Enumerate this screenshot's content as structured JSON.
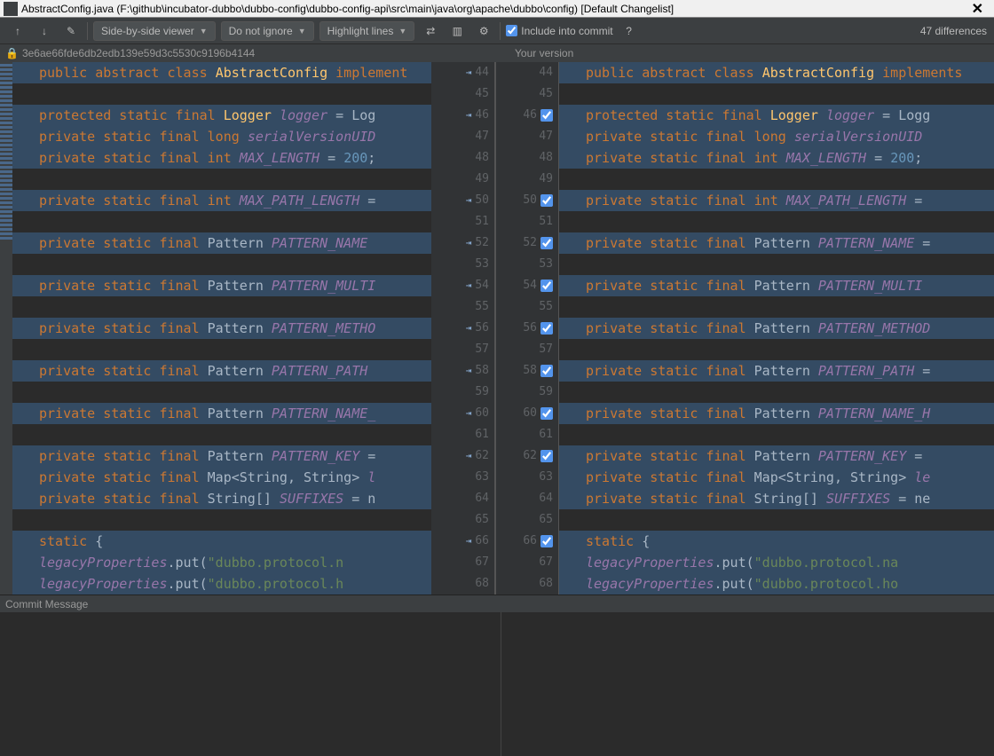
{
  "title": "AbstractConfig.java (F:\\github\\incubator-dubbo\\dubbo-config\\dubbo-config-api\\src\\main\\java\\org\\apache\\dubbo\\config) [Default Changelist]",
  "toolbar": {
    "viewer": "Side-by-side viewer",
    "ignore": "Do not ignore",
    "highlight": "Highlight lines",
    "include": "Include into commit",
    "diffcount": "47 differences"
  },
  "revision": "3e6ae66fde6db2edb139e59d3c5530c9196b4144",
  "header_right": "Your version",
  "left_gutter": [
    {
      "n": "44",
      "a": true
    },
    {
      "n": "45"
    },
    {
      "n": "46",
      "a": true
    },
    {
      "n": "47"
    },
    {
      "n": "48"
    },
    {
      "n": "49"
    },
    {
      "n": "50",
      "a": true
    },
    {
      "n": "51"
    },
    {
      "n": "52",
      "a": true
    },
    {
      "n": "53"
    },
    {
      "n": "54",
      "a": true
    },
    {
      "n": "55"
    },
    {
      "n": "56",
      "a": true
    },
    {
      "n": "57"
    },
    {
      "n": "58",
      "a": true
    },
    {
      "n": "59"
    },
    {
      "n": "60",
      "a": true
    },
    {
      "n": "61"
    },
    {
      "n": "62",
      "a": true
    },
    {
      "n": "63"
    },
    {
      "n": "64"
    },
    {
      "n": "65"
    },
    {
      "n": "66",
      "a": true
    },
    {
      "n": "67"
    },
    {
      "n": "68"
    }
  ],
  "right_gutter": [
    {
      "n": "44"
    },
    {
      "n": "45"
    },
    {
      "n": "46",
      "c": true
    },
    {
      "n": "47"
    },
    {
      "n": "48"
    },
    {
      "n": "49"
    },
    {
      "n": "50",
      "c": true
    },
    {
      "n": "51"
    },
    {
      "n": "52",
      "c": true
    },
    {
      "n": "53"
    },
    {
      "n": "54",
      "c": true
    },
    {
      "n": "55"
    },
    {
      "n": "56",
      "c": true
    },
    {
      "n": "57"
    },
    {
      "n": "58",
      "c": true
    },
    {
      "n": "59"
    },
    {
      "n": "60",
      "c": true
    },
    {
      "n": "61"
    },
    {
      "n": "62",
      "c": true
    },
    {
      "n": "63"
    },
    {
      "n": "64"
    },
    {
      "n": "65"
    },
    {
      "n": "66",
      "c": true
    },
    {
      "n": "67"
    },
    {
      "n": "68"
    }
  ],
  "code_lines": [
    {
      "hl": true,
      "tokens": [
        [
          "kw",
          "public abstract class"
        ],
        [
          "comp",
          " "
        ],
        [
          "cls",
          "AbstractConfig"
        ],
        [
          "comp",
          " "
        ],
        [
          "kw",
          "implement"
        ]
      ]
    },
    {
      "tokens": []
    },
    {
      "hl": true,
      "tokens": [
        [
          "kw",
          "protected static final "
        ],
        [
          "cls",
          "Logger"
        ],
        [
          "comp",
          " "
        ],
        [
          "ident",
          "logger"
        ],
        [
          "op",
          " = "
        ],
        [
          "typ",
          "Log"
        ]
      ]
    },
    {
      "hl": true,
      "tokens": [
        [
          "kw",
          "private static final long "
        ],
        [
          "ident",
          "serialVersionUID"
        ]
      ]
    },
    {
      "hl": true,
      "tokens": [
        [
          "kw",
          "private static final int "
        ],
        [
          "ident",
          "MAX_LENGTH"
        ],
        [
          "op",
          " = "
        ],
        [
          "num",
          "200"
        ],
        [
          "op",
          ";"
        ]
      ]
    },
    {
      "tokens": []
    },
    {
      "hl": true,
      "tokens": [
        [
          "kw",
          "private static final int "
        ],
        [
          "ident",
          "MAX_PATH_LENGTH"
        ],
        [
          "op",
          " ="
        ]
      ]
    },
    {
      "tokens": []
    },
    {
      "hl": true,
      "tokens": [
        [
          "kw",
          "private static final "
        ],
        [
          "typ",
          "Pattern"
        ],
        [
          "comp",
          " "
        ],
        [
          "ident",
          "PATTERN_NAME"
        ]
      ]
    },
    {
      "tokens": []
    },
    {
      "hl": true,
      "tokens": [
        [
          "kw",
          "private static final "
        ],
        [
          "typ",
          "Pattern"
        ],
        [
          "comp",
          " "
        ],
        [
          "ident",
          "PATTERN_MULTI"
        ]
      ]
    },
    {
      "tokens": []
    },
    {
      "hl": true,
      "tokens": [
        [
          "kw",
          "private static final "
        ],
        [
          "typ",
          "Pattern"
        ],
        [
          "comp",
          " "
        ],
        [
          "ident",
          "PATTERN_METHO"
        ]
      ]
    },
    {
      "tokens": []
    },
    {
      "hl": true,
      "tokens": [
        [
          "kw",
          "private static final "
        ],
        [
          "typ",
          "Pattern"
        ],
        [
          "comp",
          " "
        ],
        [
          "ident",
          "PATTERN_PATH"
        ]
      ]
    },
    {
      "tokens": []
    },
    {
      "hl": true,
      "tokens": [
        [
          "kw",
          "private static final "
        ],
        [
          "typ",
          "Pattern"
        ],
        [
          "comp",
          " "
        ],
        [
          "ident",
          "PATTERN_NAME_"
        ]
      ]
    },
    {
      "tokens": []
    },
    {
      "hl": true,
      "tokens": [
        [
          "kw",
          "private static final "
        ],
        [
          "typ",
          "Pattern"
        ],
        [
          "comp",
          " "
        ],
        [
          "ident",
          "PATTERN_KEY"
        ],
        [
          "op",
          " ="
        ]
      ]
    },
    {
      "hl": true,
      "tokens": [
        [
          "kw",
          "private static final "
        ],
        [
          "typ",
          "Map"
        ],
        [
          "gen",
          "<"
        ],
        [
          "typ",
          "String"
        ],
        [
          "gen",
          ", "
        ],
        [
          "typ",
          "String"
        ],
        [
          "gen",
          ">"
        ],
        [
          "comp",
          " "
        ],
        [
          "ident",
          "l"
        ]
      ]
    },
    {
      "hl": true,
      "tokens": [
        [
          "kw",
          "private static final "
        ],
        [
          "typ",
          "String"
        ],
        [
          "gen",
          "[]"
        ],
        [
          "comp",
          " "
        ],
        [
          "ident",
          "SUFFIXES"
        ],
        [
          "op",
          " = n"
        ]
      ]
    },
    {
      "tokens": []
    },
    {
      "hl": true,
      "tokens": [
        [
          "kw",
          "static "
        ],
        [
          "op",
          "{"
        ]
      ]
    },
    {
      "hl": true,
      "tokens": [
        [
          "ident",
          "    legacyProperties"
        ],
        [
          "op",
          ".put("
        ],
        [
          "str",
          "\"dubbo.protocol.n"
        ]
      ]
    },
    {
      "hl": true,
      "tokens": [
        [
          "ident",
          "    legacyProperties"
        ],
        [
          "op",
          ".put("
        ],
        [
          "str",
          "\"dubbo.protocol.h"
        ]
      ]
    }
  ],
  "code_lines_right": [
    {
      "hl": true,
      "tokens": [
        [
          "kw",
          "public abstract class"
        ],
        [
          "comp",
          " "
        ],
        [
          "cls",
          "AbstractConfig"
        ],
        [
          "comp",
          " "
        ],
        [
          "kw",
          "implements"
        ]
      ]
    },
    {
      "tokens": []
    },
    {
      "hl": true,
      "tokens": [
        [
          "kw",
          "protected static final "
        ],
        [
          "cls",
          "Logger"
        ],
        [
          "comp",
          " "
        ],
        [
          "ident",
          "logger"
        ],
        [
          "op",
          " = "
        ],
        [
          "typ",
          "Logg"
        ]
      ]
    },
    {
      "hl": true,
      "tokens": [
        [
          "kw",
          "private static final long "
        ],
        [
          "ident",
          "serialVersionUID"
        ]
      ]
    },
    {
      "hl": true,
      "tokens": [
        [
          "kw",
          "private static final int "
        ],
        [
          "ident",
          "MAX_LENGTH"
        ],
        [
          "op",
          " = "
        ],
        [
          "num",
          "200"
        ],
        [
          "op",
          ";"
        ]
      ]
    },
    {
      "tokens": []
    },
    {
      "hl": true,
      "tokens": [
        [
          "kw",
          "private static final int "
        ],
        [
          "ident",
          "MAX_PATH_LENGTH"
        ],
        [
          "op",
          " ="
        ]
      ]
    },
    {
      "tokens": []
    },
    {
      "hl": true,
      "tokens": [
        [
          "kw",
          "private static final "
        ],
        [
          "typ",
          "Pattern"
        ],
        [
          "comp",
          " "
        ],
        [
          "ident",
          "PATTERN_NAME"
        ],
        [
          "op",
          " ="
        ]
      ]
    },
    {
      "tokens": []
    },
    {
      "hl": true,
      "tokens": [
        [
          "kw",
          "private static final "
        ],
        [
          "typ",
          "Pattern"
        ],
        [
          "comp",
          " "
        ],
        [
          "ident",
          "PATTERN_MULTI"
        ]
      ]
    },
    {
      "tokens": []
    },
    {
      "hl": true,
      "tokens": [
        [
          "kw",
          "private static final "
        ],
        [
          "typ",
          "Pattern"
        ],
        [
          "comp",
          " "
        ],
        [
          "ident",
          "PATTERN_METHOD"
        ]
      ]
    },
    {
      "tokens": []
    },
    {
      "hl": true,
      "tokens": [
        [
          "kw",
          "private static final "
        ],
        [
          "typ",
          "Pattern"
        ],
        [
          "comp",
          " "
        ],
        [
          "ident",
          "PATTERN_PATH"
        ],
        [
          "op",
          " ="
        ]
      ]
    },
    {
      "tokens": []
    },
    {
      "hl": true,
      "tokens": [
        [
          "kw",
          "private static final "
        ],
        [
          "typ",
          "Pattern"
        ],
        [
          "comp",
          " "
        ],
        [
          "ident",
          "PATTERN_NAME_H"
        ]
      ]
    },
    {
      "tokens": []
    },
    {
      "hl": true,
      "tokens": [
        [
          "kw",
          "private static final "
        ],
        [
          "typ",
          "Pattern"
        ],
        [
          "comp",
          " "
        ],
        [
          "ident",
          "PATTERN_KEY"
        ],
        [
          "op",
          " ="
        ]
      ]
    },
    {
      "hl": true,
      "tokens": [
        [
          "kw",
          "private static final "
        ],
        [
          "typ",
          "Map"
        ],
        [
          "gen",
          "<"
        ],
        [
          "typ",
          "String"
        ],
        [
          "gen",
          ", "
        ],
        [
          "typ",
          "String"
        ],
        [
          "gen",
          ">"
        ],
        [
          "comp",
          " "
        ],
        [
          "ident",
          "le"
        ]
      ]
    },
    {
      "hl": true,
      "tokens": [
        [
          "kw",
          "private static final "
        ],
        [
          "typ",
          "String"
        ],
        [
          "gen",
          "[]"
        ],
        [
          "comp",
          " "
        ],
        [
          "ident",
          "SUFFIXES"
        ],
        [
          "op",
          " = ne"
        ]
      ]
    },
    {
      "tokens": []
    },
    {
      "hl": true,
      "tokens": [
        [
          "kw",
          "static "
        ],
        [
          "op",
          "{"
        ]
      ]
    },
    {
      "hl": true,
      "tokens": [
        [
          "ident",
          "    legacyProperties"
        ],
        [
          "op",
          ".put("
        ],
        [
          "str",
          "\"dubbo.protocol.na"
        ]
      ]
    },
    {
      "hl": true,
      "tokens": [
        [
          "ident",
          "    legacyProperties"
        ],
        [
          "op",
          ".put("
        ],
        [
          "str",
          "\"dubbo.protocol.ho"
        ]
      ]
    }
  ],
  "commit_label": "Commit Message"
}
